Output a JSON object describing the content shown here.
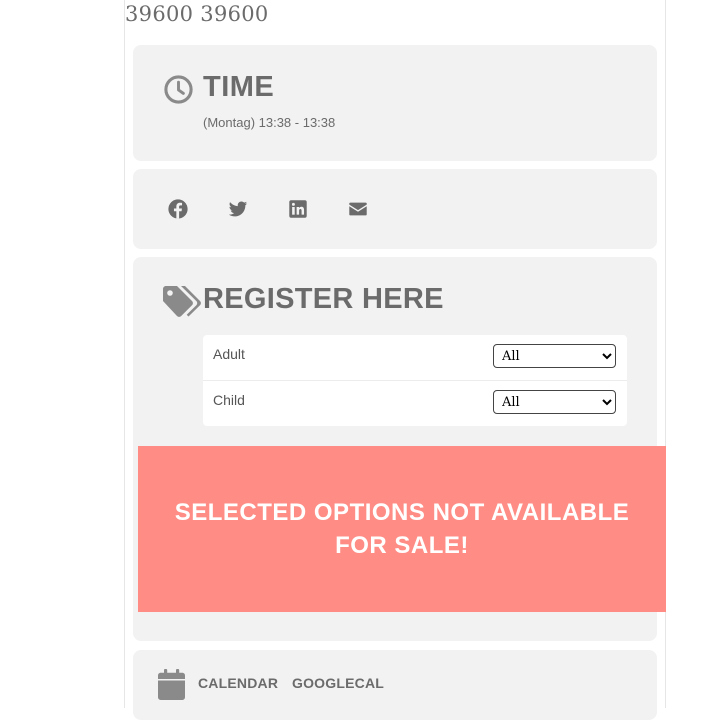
{
  "header": {
    "title": "39600 39600"
  },
  "time": {
    "icon": "clock-icon",
    "title": "TIME",
    "subtitle": "(Montag) 13:38 - 13:38"
  },
  "share": {
    "icons": [
      "facebook-icon",
      "twitter-icon",
      "linkedin-icon",
      "email-icon"
    ]
  },
  "register": {
    "icon": "tags-icon",
    "title": "REGISTER HERE",
    "tickets": [
      {
        "label": "Adult",
        "selected": "All"
      },
      {
        "label": "Child",
        "selected": "All"
      }
    ]
  },
  "alert": {
    "message": "SELECTED OPTIONS NOT AVAILABLE FOR SALE!",
    "color": "#ff8c85"
  },
  "calendar": {
    "icon": "calendar-icon",
    "links": [
      "CALENDAR",
      "GOOGLECAL"
    ]
  }
}
